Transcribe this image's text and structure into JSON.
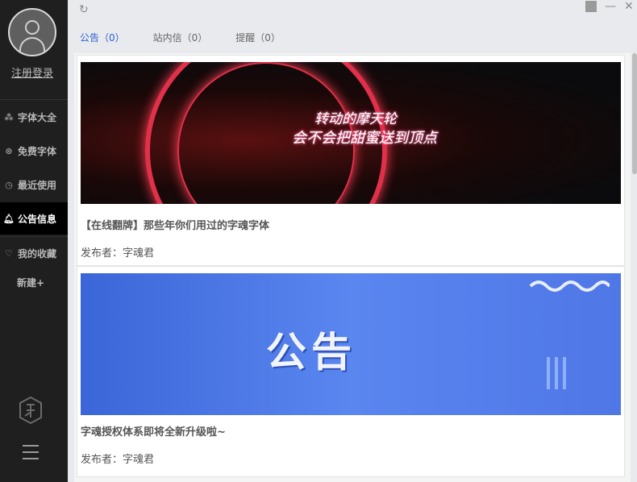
{
  "sidebar": {
    "login_label": "注册登录",
    "items": [
      {
        "label": "字体大全",
        "icon": "grid-icon"
      },
      {
        "label": "免费字体",
        "icon": "coin-icon"
      },
      {
        "label": "最近使用",
        "icon": "clock-icon"
      },
      {
        "label": "公告信息",
        "icon": "bell-icon",
        "active": true
      },
      {
        "label": "我的收藏",
        "icon": "heart-icon"
      }
    ],
    "new_label": "新建+"
  },
  "tabs": [
    {
      "label": "公告（0）",
      "active": true
    },
    {
      "label": "站内信（0）"
    },
    {
      "label": "提醒（0）"
    }
  ],
  "announcements": [
    {
      "title": "【在线翻牌】那些年你们用过的字魂字体",
      "publisher": "发布者：字魂君",
      "image": "ferris-wheel-night"
    },
    {
      "title": "字魂授权体系即将全新升级啦~",
      "publisher": "发布者：字魂君",
      "image": "blue-notice-banner"
    }
  ],
  "banner2_text": "公告",
  "banner1_lines": [
    "转动的摩天轮",
    "会不会把甜蜜送到顶点"
  ],
  "colors": {
    "sidebar_bg": "#1f1f1f",
    "active_tab": "#2f5fcf",
    "banner_blue": "#4f77e6"
  }
}
